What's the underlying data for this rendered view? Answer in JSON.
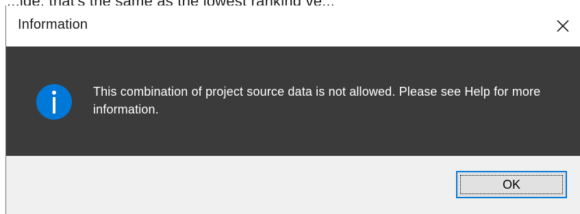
{
  "background_text": "...ide, that's the same as the lowest ranking ve...",
  "dialog": {
    "title": "Information",
    "close_label": "Close",
    "message": "This combination of project source data is not allowed. Please see Help for more information.",
    "icon": "info-icon",
    "ok_label": "OK"
  },
  "colors": {
    "content_background": "#3b3b3b",
    "message_text": "#ffffff",
    "icon_fill": "#0078d7",
    "footer_background": "#f0f0f0",
    "button_focus_border": "#0078d7"
  }
}
